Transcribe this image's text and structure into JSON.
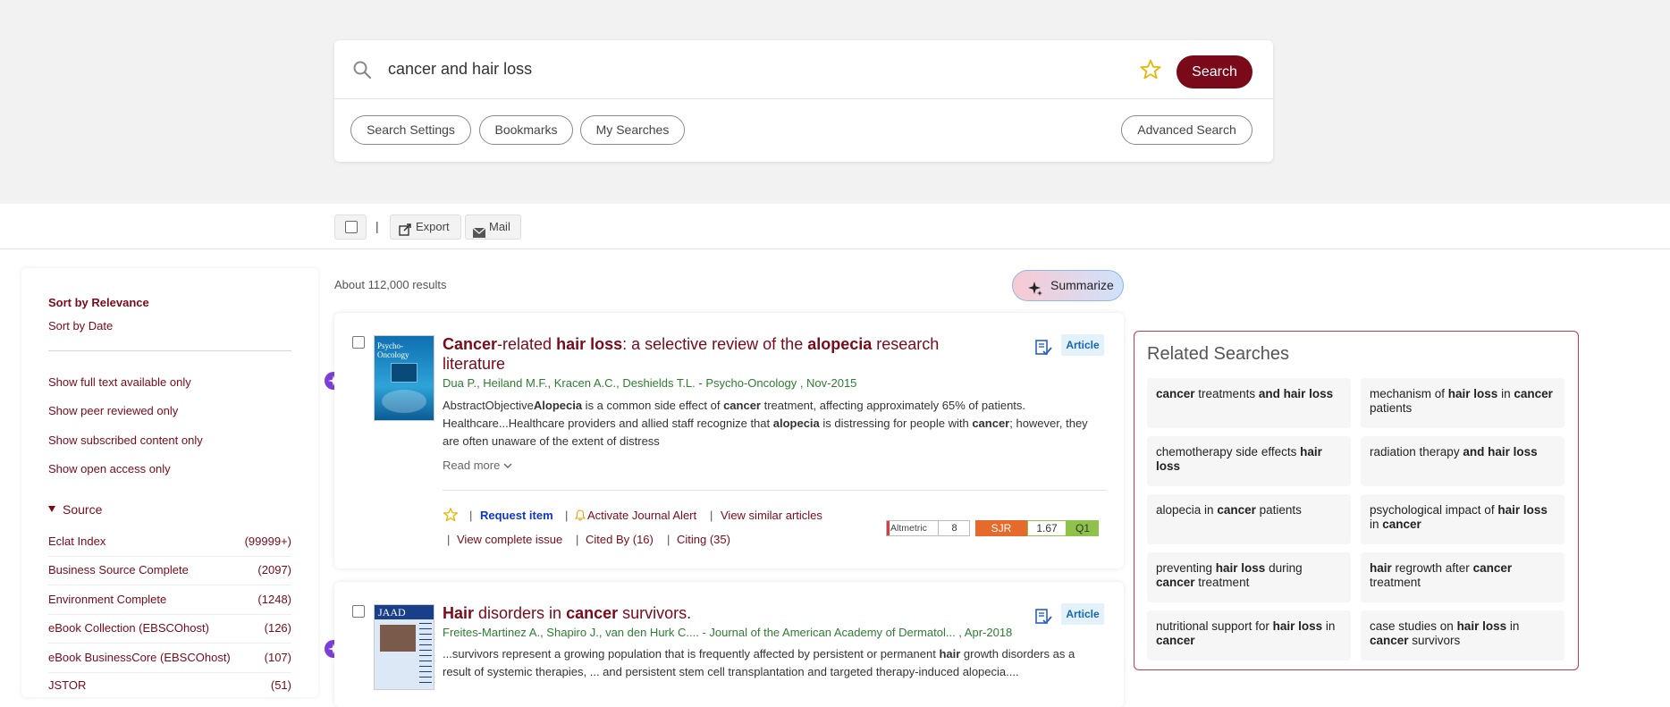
{
  "search": {
    "query": "cancer and hair loss",
    "search_label": "Search",
    "pills": [
      "Search Settings",
      "Bookmarks",
      "My Searches"
    ],
    "advanced_label": "Advanced Search"
  },
  "toolbar": {
    "separator": "|",
    "export_label": "Export",
    "mail_label": "Mail"
  },
  "sidebar": {
    "sort": [
      "Sort by Relevance",
      "Sort by Date"
    ],
    "filters": [
      "Show full text available only",
      "Show peer reviewed only",
      "Show subscribed content only",
      "Show open access only"
    ],
    "source_heading": "Source",
    "sources": [
      {
        "name": "Eclat Index",
        "count": "(99999+)"
      },
      {
        "name": "Business Source Complete",
        "count": "(2097)"
      },
      {
        "name": "Environment Complete",
        "count": "(1248)"
      },
      {
        "name": "eBook Collection (EBSCOhost)",
        "count": "(126)"
      },
      {
        "name": "eBook BusinessCore (EBSCOhost)",
        "count": "(107)"
      },
      {
        "name": "JSTOR",
        "count": "(51)"
      }
    ]
  },
  "results": {
    "count_text": "About 112,000 results",
    "summarize_label": "Summarize",
    "items": [
      {
        "title_segments": [
          {
            "t": "Cancer",
            "b": true
          },
          {
            "t": "-related ",
            "b": false
          },
          {
            "t": "hair loss",
            "b": true
          },
          {
            "t": ": a selective review of the ",
            "b": false
          },
          {
            "t": "alopecia",
            "b": true
          },
          {
            "t": " research literature",
            "b": false
          }
        ],
        "authors": "Dua P., Heiland M.F., Kracen A.C., Deshields T.L. - Psycho-Oncology , Nov-2015",
        "abstract_segments": [
          {
            "t": "AbstractObjective",
            "b": false
          },
          {
            "t": "Alopecia",
            "b": true
          },
          {
            "t": " is a common side effect of ",
            "b": false
          },
          {
            "t": "cancer",
            "b": true
          },
          {
            "t": " treatment, affecting approximately 65% of patients. Healthcare...Healthcare providers and allied staff recognize that ",
            "b": false
          },
          {
            "t": "alopecia",
            "b": true
          },
          {
            "t": " is distressing for people with ",
            "b": false
          },
          {
            "t": "cancer",
            "b": true
          },
          {
            "t": "; however, they are often unaware of the extent of distress",
            "b": false
          }
        ],
        "read_more": "Read more",
        "type": "Article",
        "thumb_title": "Psycho-Oncology",
        "actions": {
          "request": "Request item",
          "alert": "Activate Journal Alert",
          "similar": "View similar articles",
          "issue": "View complete issue",
          "cited_by": "Cited By (16)",
          "citing": "Citing (35)"
        },
        "metrics": {
          "altmetric_label": "Altmetric",
          "altmetric_value": "8",
          "sjr_label": "SJR",
          "sjr_value": "1.67",
          "quartile": "Q1"
        }
      },
      {
        "title_segments": [
          {
            "t": "Hair",
            "b": true
          },
          {
            "t": " disorders in ",
            "b": false
          },
          {
            "t": "cancer",
            "b": true
          },
          {
            "t": " survivors.",
            "b": false
          }
        ],
        "authors": "Freites-Martinez A., Shapiro J., van den Hurk C.... - Journal of the American Academy of Dermatol... , Apr-2018",
        "abstract_segments": [
          {
            "t": "...survivors represent a growing population that is frequently affected by persistent or permanent ",
            "b": false
          },
          {
            "t": "hair",
            "b": true
          },
          {
            "t": " growth disorders as a result of systemic therapies, ... and persistent stem cell transplantation and targeted therapy-induced alopecia....",
            "b": false
          }
        ],
        "type": "Article",
        "thumb_title": "JAAD"
      }
    ]
  },
  "related": {
    "heading": "Related Searches",
    "items": [
      [
        {
          "t": "cancer",
          "b": true
        },
        {
          "t": " treatments ",
          "b": false
        },
        {
          "t": "and hair loss",
          "b": true
        }
      ],
      [
        {
          "t": "mechanism of ",
          "b": false
        },
        {
          "t": "hair loss",
          "b": true
        },
        {
          "t": " in ",
          "b": false
        },
        {
          "t": "cancer",
          "b": true
        },
        {
          "t": " patients",
          "b": false
        }
      ],
      [
        {
          "t": "chemotherapy side effects ",
          "b": false
        },
        {
          "t": "hair loss",
          "b": true
        }
      ],
      [
        {
          "t": "radiation therapy ",
          "b": false
        },
        {
          "t": "and hair loss",
          "b": true
        }
      ],
      [
        {
          "t": "alopecia in ",
          "b": false
        },
        {
          "t": "cancer",
          "b": true
        },
        {
          "t": " patients",
          "b": false
        }
      ],
      [
        {
          "t": "psychological impact of ",
          "b": false
        },
        {
          "t": "hair loss",
          "b": true
        },
        {
          "t": " in ",
          "b": false
        },
        {
          "t": "cancer",
          "b": true
        }
      ],
      [
        {
          "t": "preventing ",
          "b": false
        },
        {
          "t": "hair loss",
          "b": true
        },
        {
          "t": " during ",
          "b": false
        },
        {
          "t": "cancer",
          "b": true
        },
        {
          "t": " treatment",
          "b": false
        }
      ],
      [
        {
          "t": "hair",
          "b": true
        },
        {
          "t": " regrowth after ",
          "b": false
        },
        {
          "t": "cancer",
          "b": true
        },
        {
          "t": " treatment",
          "b": false
        }
      ],
      [
        {
          "t": "nutritional support for ",
          "b": false
        },
        {
          "t": "hair loss",
          "b": true
        },
        {
          "t": " in ",
          "b": false
        },
        {
          "t": "cancer",
          "b": true
        }
      ],
      [
        {
          "t": "case studies on ",
          "b": false
        },
        {
          "t": "hair loss",
          "b": true
        },
        {
          "t": " in ",
          "b": false
        },
        {
          "t": "cancer",
          "b": true
        },
        {
          "t": " survivors",
          "b": false
        }
      ]
    ]
  },
  "colors": {
    "brand": "#7a0a1a",
    "author_green": "#2e7d32",
    "badge_blue": "#1666b0",
    "related_border": "#c23a4e",
    "ai_purple": "#7b3fd8"
  },
  "icons": [
    "search-icon",
    "star-icon",
    "export-icon",
    "mail-icon",
    "caret-down-icon",
    "sparkle-icon",
    "cite-icon",
    "ai-icon",
    "bell-icon",
    "chevron-down-icon"
  ]
}
